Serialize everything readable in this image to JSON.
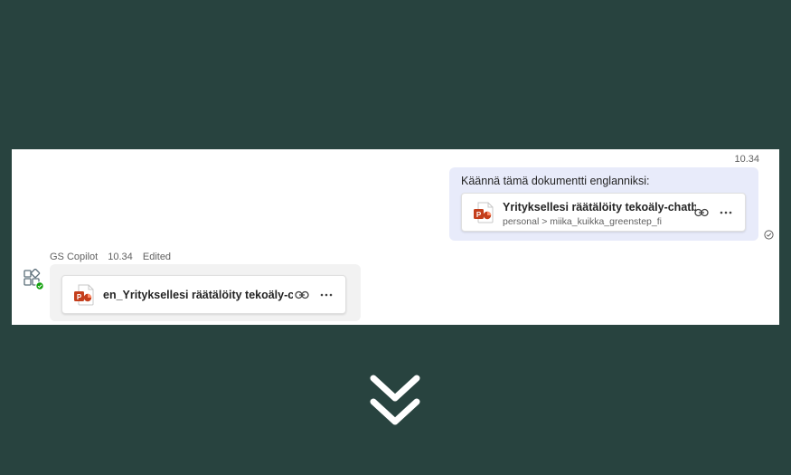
{
  "chat": {
    "user_message": {
      "time": "10.34",
      "text": "Käännä tämä dokumentti englanniksi:",
      "attachment": {
        "name": "Yrityksellesi räätälöity tekoäly-chatb...",
        "path": "personal > miika_kuikka_greenstep_fi",
        "icon": "powerpoint-icon"
      },
      "status_icon": "read-receipt-icon"
    },
    "bot_message": {
      "sender": "GS Copilot",
      "time": "10.34",
      "edited": "Edited",
      "attachment": {
        "name": "en_Yrityksellesi räätälöity tekoäly-c...",
        "icon": "powerpoint-icon"
      }
    }
  },
  "colors": {
    "background": "#28433f",
    "user_bubble": "#e8ebfa",
    "bot_bubble": "#f2f2f2",
    "powerpoint": "#c43e1c",
    "presence": "#13a10e"
  },
  "decor": {
    "chevron_icon": "double-chevron-down-icon"
  }
}
